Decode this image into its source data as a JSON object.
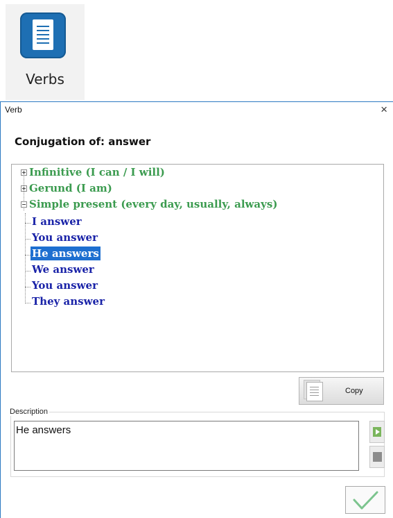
{
  "ribbon": {
    "label": "Verbs",
    "icon": "document-list-icon",
    "accent": "#1e6fb3"
  },
  "dialog": {
    "title": "Verb",
    "close_glyph": "×",
    "heading": "Conjugation of: answer",
    "tree": {
      "groups": [
        {
          "label": "Infinitive (I can / I will)",
          "expanded": false
        },
        {
          "label": "Gerund (I am)",
          "expanded": false
        },
        {
          "label": "Simple present (every day, usually, always)",
          "expanded": true,
          "children": [
            "I answer",
            "You answer",
            "He answers",
            "We answer",
            "You answer",
            "They answer"
          ],
          "selected_child": "He answers"
        }
      ]
    },
    "copy_label": "Copy",
    "description": {
      "label": "Description",
      "value": "He answers"
    },
    "colors": {
      "group_text": "#3b9b4f",
      "item_text": "#1a23a8",
      "selection": "#1e6fd0"
    }
  }
}
